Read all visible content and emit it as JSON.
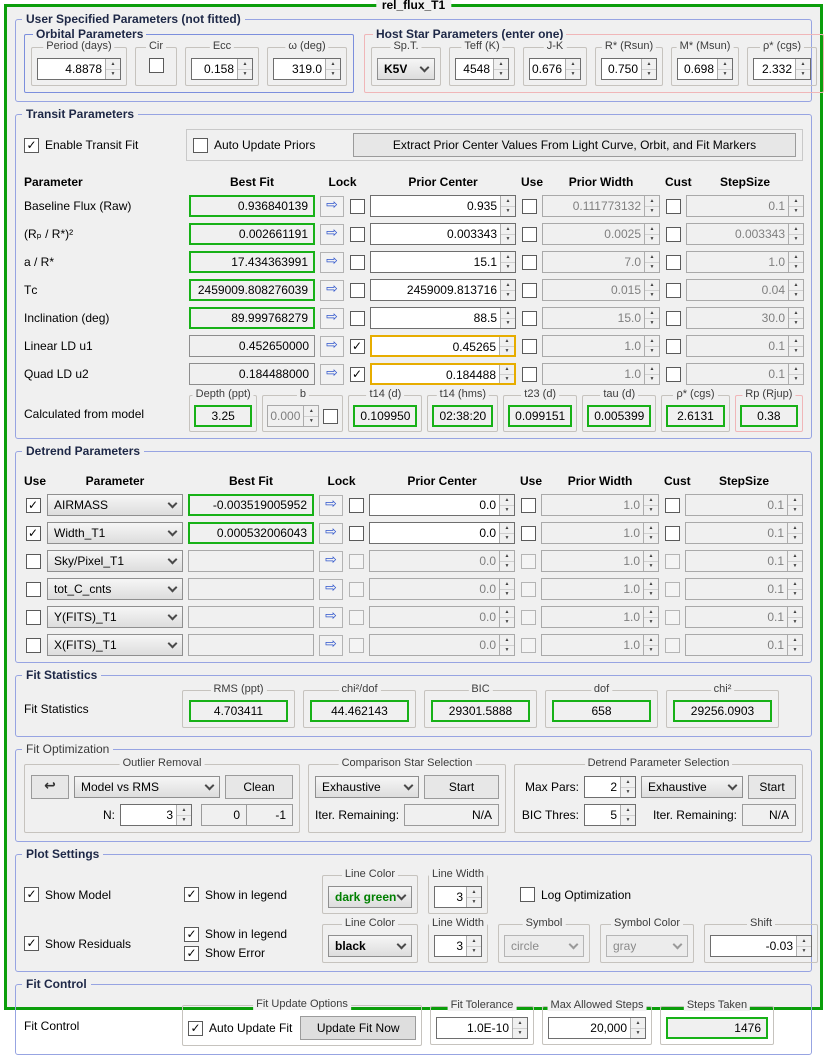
{
  "window": {
    "title": "rel_flux_T1"
  },
  "icons": {
    "transfer_arrow": "⇨"
  },
  "user_params": {
    "title": "User Specified Parameters (not fitted)",
    "orbital": {
      "title": "Orbital Parameters",
      "period_label": "Period (days)",
      "period": "4.8878",
      "cir_label": "Cir",
      "cir_checked": false,
      "ecc_label": "Ecc",
      "ecc": "0.158",
      "omega_label": "ω (deg)",
      "omega": "319.0"
    },
    "host": {
      "title": "Host Star Parameters (enter one)",
      "spt_label": "Sp.T.",
      "spt": "K5V",
      "teff_label": "Teff (K)",
      "teff": "4548",
      "jk_label": "J-K",
      "jk": "0.676",
      "rstar_label": "R* (Rsun)",
      "rstar": "0.750",
      "mstar_label": "M* (Msun)",
      "mstar": "0.698",
      "rho_label": "ρ* (cgs)",
      "rho": "2.332"
    }
  },
  "transit": {
    "title": "Transit Parameters",
    "enable_label": "Enable Transit Fit",
    "enable_checked": true,
    "auto_update_label": "Auto Update Priors",
    "auto_update_checked": false,
    "extract_button": "Extract Prior Center Values From Light Curve, Orbit, and Fit Markers",
    "headers": {
      "parameter": "Parameter",
      "best_fit": "Best Fit",
      "lock": "Lock",
      "prior_center": "Prior Center",
      "use": "Use",
      "prior_width": "Prior Width",
      "cust": "Cust",
      "step_size": "StepSize"
    },
    "rows": [
      {
        "param": "Baseline Flux (Raw)",
        "best": "0.936840139",
        "lock": false,
        "prior": "0.935",
        "width": "0.111773132",
        "step": "0.1"
      },
      {
        "param": "(Rₚ / R*)²",
        "best": "0.002661191",
        "lock": false,
        "prior": "0.003343",
        "width": "0.0025",
        "step": "0.003343"
      },
      {
        "param": "a / R*",
        "best": "17.434363991",
        "lock": false,
        "prior": "15.1",
        "width": "7.0",
        "step": "1.0"
      },
      {
        "param": "Tᴄ",
        "best": "2459009.808276039",
        "lock": false,
        "prior": "2459009.813716",
        "width": "0.015",
        "step": "0.04"
      },
      {
        "param": "Inclination (deg)",
        "best": "89.999768279",
        "lock": false,
        "prior": "88.5",
        "width": "15.0",
        "step": "30.0"
      },
      {
        "param": "Linear LD u1",
        "best": "0.452650000",
        "lock": true,
        "prior": "0.45265",
        "width": "1.0",
        "step": "0.1"
      },
      {
        "param": "Quad LD u2",
        "best": "0.184488000",
        "lock": true,
        "prior": "0.184488",
        "width": "1.0",
        "step": "0.1"
      }
    ],
    "calculated_label": "Calculated from model",
    "calculated": [
      {
        "label": "Depth (ppt)",
        "value": "3.25"
      },
      {
        "label": "b",
        "value": "0.000"
      },
      {
        "label": "t14 (d)",
        "value": "0.109950"
      },
      {
        "label": "t14 (hms)",
        "value": "02:38:20"
      },
      {
        "label": "t23 (d)",
        "value": "0.099151"
      },
      {
        "label": "tau (d)",
        "value": "0.005399"
      },
      {
        "label": "ρ* (cgs)",
        "value": "2.6131"
      },
      {
        "label": "Rp (Rjup)",
        "value": "0.38"
      }
    ]
  },
  "detrend": {
    "title": "Detrend Parameters",
    "headers": {
      "use": "Use",
      "parameter": "Parameter",
      "best_fit": "Best Fit",
      "lock": "Lock",
      "prior_center": "Prior Center",
      "use2": "Use",
      "prior_width": "Prior Width",
      "cust": "Cust",
      "step_size": "StepSize"
    },
    "rows": [
      {
        "use": true,
        "param": "AIRMASS",
        "best": "-0.003519005952",
        "prior": "0.0",
        "width": "1.0",
        "step": "0.1"
      },
      {
        "use": true,
        "param": "Width_T1",
        "best": "0.000532006043",
        "prior": "0.0",
        "width": "1.0",
        "step": "0.1"
      },
      {
        "use": false,
        "param": "Sky/Pixel_T1",
        "best": "",
        "prior": "0.0",
        "width": "1.0",
        "step": "0.1"
      },
      {
        "use": false,
        "param": "tot_C_cnts",
        "best": "",
        "prior": "0.0",
        "width": "1.0",
        "step": "0.1"
      },
      {
        "use": false,
        "param": "Y(FITS)_T1",
        "best": "",
        "prior": "0.0",
        "width": "1.0",
        "step": "0.1"
      },
      {
        "use": false,
        "param": "X(FITS)_T1",
        "best": "",
        "prior": "0.0",
        "width": "1.0",
        "step": "0.1"
      }
    ]
  },
  "fit_stats": {
    "title": "Fit Statistics",
    "row_label": "Fit Statistics",
    "fields": [
      {
        "label": "RMS (ppt)",
        "value": "4.703411"
      },
      {
        "label": "chi²/dof",
        "value": "44.462143"
      },
      {
        "label": "BIC",
        "value": "29301.5888"
      },
      {
        "label": "dof",
        "value": "658"
      },
      {
        "label": "chi²",
        "value": "29256.0903"
      }
    ]
  },
  "fit_opt": {
    "title": "Fit Optimization",
    "outlier": {
      "title": "Outlier Removal",
      "undo_icon": "↩",
      "method": "Model vs RMS",
      "clean_button": "Clean",
      "n_label": "N:",
      "n_value": "3",
      "removed": "0",
      "remaining": "-1"
    },
    "comp": {
      "title": "Comparison Star Selection",
      "method": "Exhaustive",
      "start_button": "Start",
      "iter_label": "Iter. Remaining:",
      "iter_value": "N/A"
    },
    "detrend_sel": {
      "title": "Detrend Parameter Selection",
      "max_pars_label": "Max Pars:",
      "max_pars": "2",
      "method": "Exhaustive",
      "start_button": "Start",
      "bic_label": "BIC Thres:",
      "bic_value": "5",
      "iter_label": "Iter. Remaining:",
      "iter_value": "N/A"
    }
  },
  "plot": {
    "title": "Plot Settings",
    "show_model_label": "Show Model",
    "show_model_checked": true,
    "model_legend_label": "Show in legend",
    "model_legend_checked": true,
    "model_line_color": {
      "title": "Line Color",
      "value": "dark green"
    },
    "model_line_width": {
      "title": "Line Width",
      "value": "3"
    },
    "log_opt_label": "Log Optimization",
    "log_opt_checked": false,
    "show_residuals_label": "Show Residuals",
    "show_residuals_checked": true,
    "resid_legend_label": "Show in legend",
    "resid_legend_checked": true,
    "show_error_label": "Show Error",
    "show_error_checked": true,
    "resid_line_color": {
      "title": "Line Color",
      "value": "black"
    },
    "resid_line_width": {
      "title": "Line Width",
      "value": "3"
    },
    "symbol": {
      "title": "Symbol",
      "value": "circle"
    },
    "symbol_color": {
      "title": "Symbol Color",
      "value": "gray"
    },
    "shift": {
      "title": "Shift",
      "value": "-0.03"
    }
  },
  "fit_control": {
    "title": "Fit Control",
    "row_label": "Fit Control",
    "update_options": {
      "title": "Fit Update Options",
      "auto_label": "Auto Update Fit",
      "auto_checked": true,
      "button": "Update Fit Now"
    },
    "tolerance": {
      "title": "Fit Tolerance",
      "value": "1.0E-10"
    },
    "max_steps": {
      "title": "Max Allowed Steps",
      "value": "20,000"
    },
    "steps_taken": {
      "title": "Steps Taken",
      "value": "1476"
    }
  }
}
